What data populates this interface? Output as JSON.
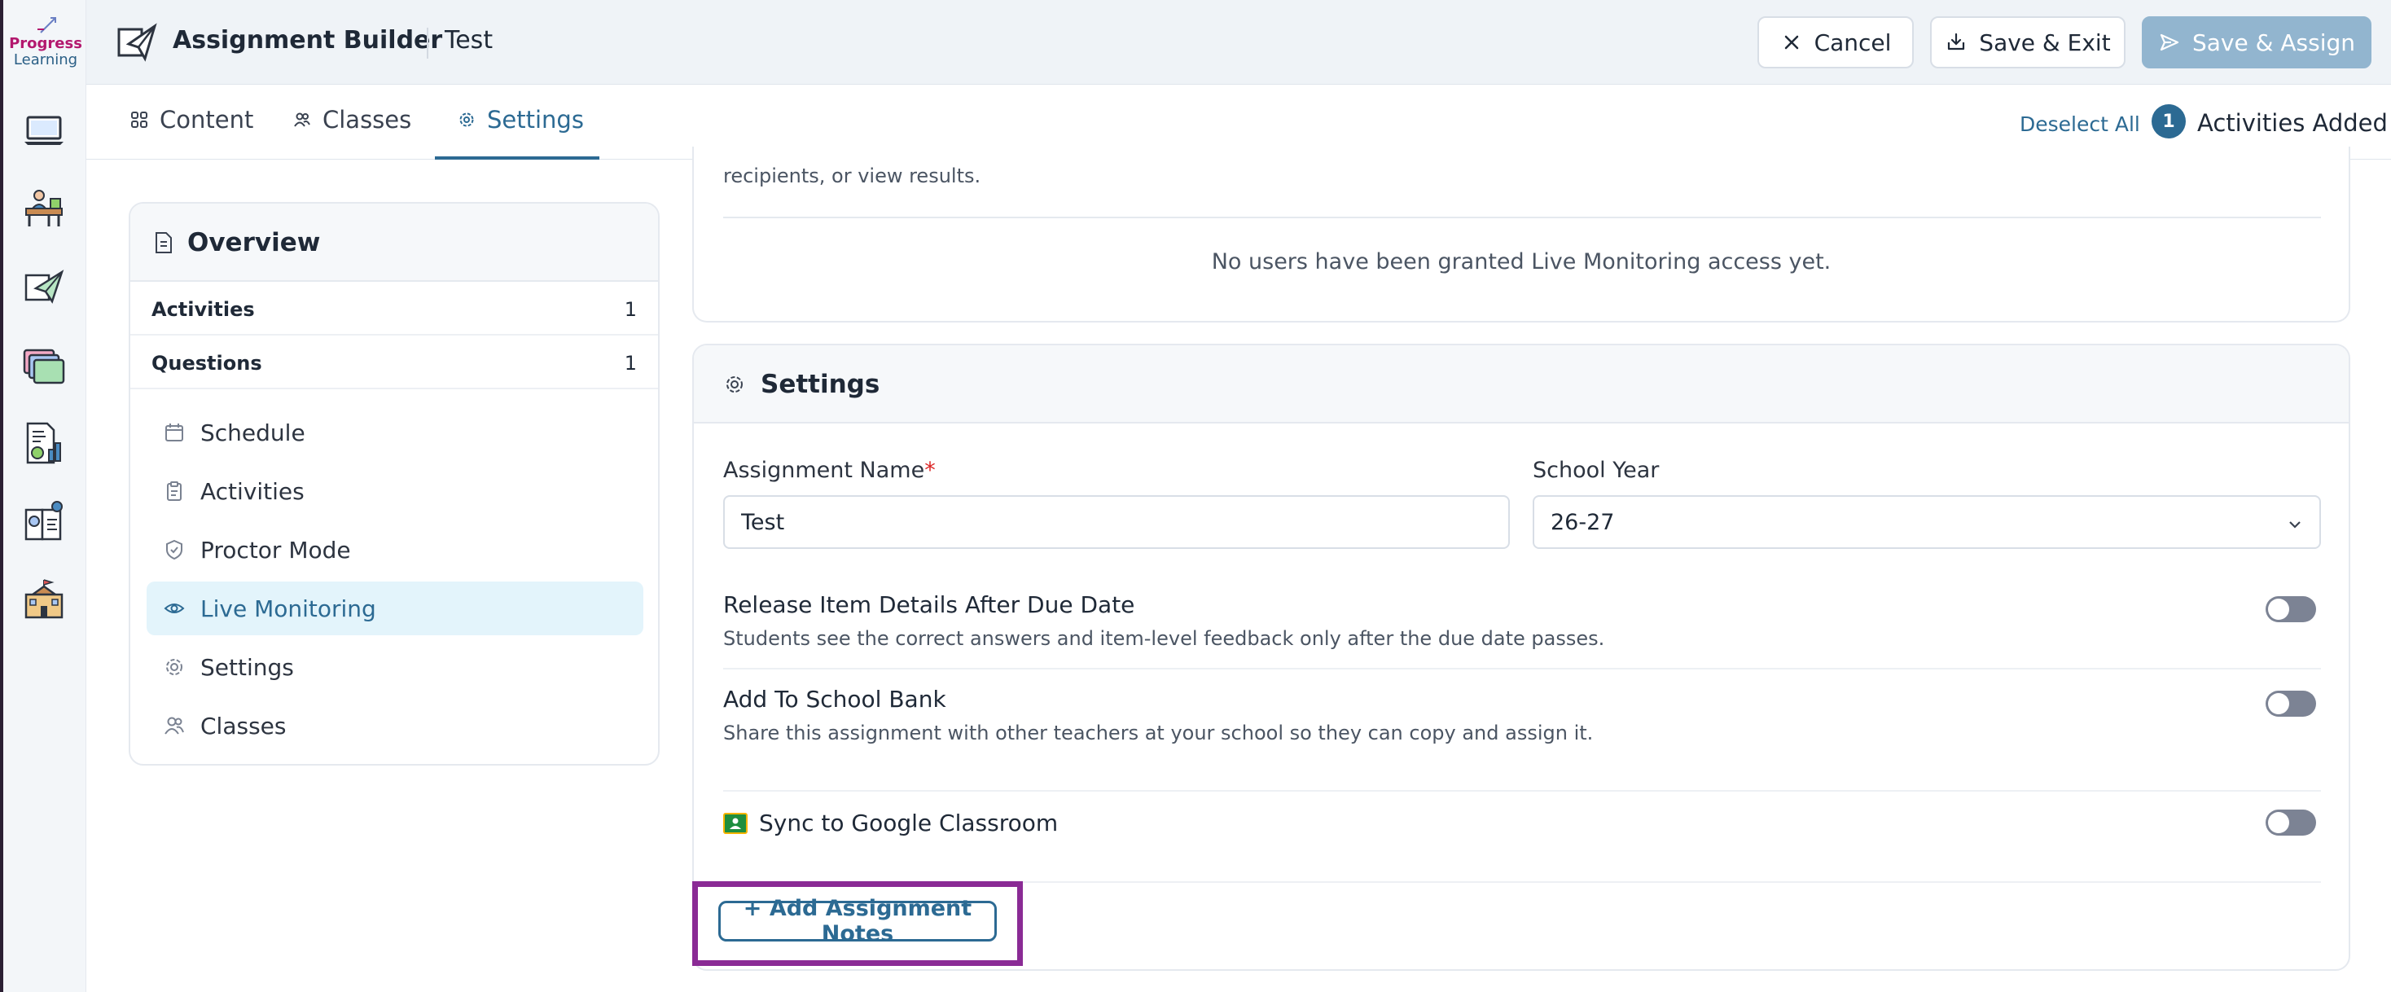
{
  "app": {
    "logo_line1": "Progress",
    "logo_line2": "Learning",
    "title": "Assignment Builder",
    "assignment_name": "Test"
  },
  "header": {
    "cancel_label": "Cancel",
    "save_exit_label": "Save & Exit",
    "save_assign_label": "Save & Assign"
  },
  "rail": {
    "icons": [
      "laptop-icon",
      "teacher-desk-icon",
      "paper-plane-icon",
      "folders-icon",
      "report-icon",
      "lesson-book-icon",
      "school-building-icon"
    ]
  },
  "tabs": [
    {
      "label": "Content",
      "icon": "grid-icon",
      "active": false
    },
    {
      "label": "Classes",
      "icon": "people-icon",
      "active": false
    },
    {
      "label": "Settings",
      "icon": "gear-icon",
      "active": true
    }
  ],
  "selection": {
    "deselect_label": "Deselect All",
    "count": "1",
    "count_label": "Activities Added"
  },
  "overview": {
    "title": "Overview",
    "stats": [
      {
        "label": "Activities",
        "value": "1"
      },
      {
        "label": "Questions",
        "value": "1"
      }
    ],
    "nav": [
      {
        "label": "Schedule",
        "icon": "calendar-icon",
        "active": false
      },
      {
        "label": "Activities",
        "icon": "clipboard-icon",
        "active": false
      },
      {
        "label": "Proctor Mode",
        "icon": "shield-check-icon",
        "active": false
      },
      {
        "label": "Live Monitoring",
        "icon": "eye-icon",
        "active": true
      },
      {
        "label": "Settings",
        "icon": "gear-icon",
        "active": false
      },
      {
        "label": "Classes",
        "icon": "people-icon",
        "active": false
      }
    ]
  },
  "live_monitoring": {
    "clipped_text": "recipients, or view results.",
    "empty_message": "No users have been granted Live Monitoring access yet."
  },
  "settings": {
    "title": "Settings",
    "assignment_name_label": "Assignment Name",
    "required_mark": "*",
    "assignment_name_value": "Test",
    "school_year_label": "School Year",
    "school_year_value": "26-27",
    "options": [
      {
        "title": "Release Item Details After Due Date",
        "description": "Students see the correct answers and item-level feedback only after the due date passes.",
        "enabled": false
      },
      {
        "title": "Add To School Bank",
        "description": "Share this assignment with other teachers at your school so they can copy and assign it.",
        "enabled": false
      },
      {
        "title": "Sync to Google Classroom",
        "description": "",
        "enabled": false
      }
    ],
    "add_notes_label": "+ Add Assignment Notes"
  },
  "colors": {
    "accent": "#2c6a93",
    "primary_disabled": "#92b5cf",
    "highlight_frame": "#8a2b95",
    "active_nav_bg": "#e3f4fb",
    "required": "#dc2626"
  }
}
